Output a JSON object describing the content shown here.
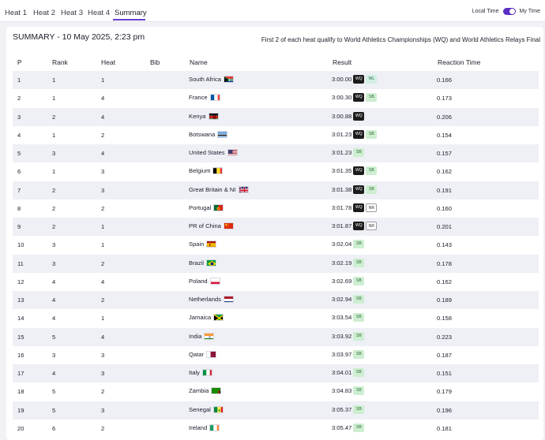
{
  "tabs": [
    "Heat 1",
    "Heat 2",
    "Heat 3",
    "Heat 4",
    "Summary"
  ],
  "active_tab": "Summary",
  "toggle": {
    "left_label": "Local Time",
    "right_label": "My Time"
  },
  "summary": {
    "title": "SUMMARY - 10 May 2025, 2:23 pm",
    "note": "First 2 of each heat qualify to World Athletics Championships (WQ) and World Athletics Relays Final"
  },
  "columns": {
    "p": "P",
    "rank": "Rank",
    "heat": "Heat",
    "bib": "Bib",
    "name": "Name",
    "result": "Result",
    "rt": "Reaction Time"
  },
  "colors": {
    "accent": "#6a3fd0",
    "row_alt": "#eef0f6",
    "wq": "#1c1c1c",
    "sb": "#cdeed0"
  },
  "rows": [
    {
      "p": "1",
      "rank": "1",
      "heat": "1",
      "name": "South Africa",
      "flag": "rsa",
      "result": "3:00.00",
      "badges": [
        "WQ",
        "WL"
      ],
      "rt": "0.166"
    },
    {
      "p": "2",
      "rank": "1",
      "heat": "4",
      "name": "France",
      "flag": "fra",
      "result": "3:00.30",
      "badges": [
        "WQ",
        "SB"
      ],
      "rt": "0.173"
    },
    {
      "p": "3",
      "rank": "2",
      "heat": "4",
      "name": "Kenya",
      "flag": "ken",
      "result": "3:00.88",
      "badges": [
        "WQ"
      ],
      "rt": "0.206"
    },
    {
      "p": "4",
      "rank": "1",
      "heat": "2",
      "name": "Botswana",
      "flag": "bot",
      "result": "3:01.23",
      "badges": [
        "WQ",
        "SB"
      ],
      "rt": "0.154"
    },
    {
      "p": "5",
      "rank": "3",
      "heat": "4",
      "name": "United States",
      "flag": "usa",
      "result": "3:01.23",
      "badges": [
        "SB"
      ],
      "rt": "0.157"
    },
    {
      "p": "6",
      "rank": "1",
      "heat": "3",
      "name": "Belgium",
      "flag": "bel",
      "result": "3:01.35",
      "badges": [
        "WQ",
        "SB"
      ],
      "rt": "0.162"
    },
    {
      "p": "7",
      "rank": "2",
      "heat": "3",
      "name": "Great Britain & NI",
      "flag": "gbr",
      "result": "3:01.38",
      "badges": [
        "WQ",
        "SB"
      ],
      "rt": "0.191"
    },
    {
      "p": "8",
      "rank": "2",
      "heat": "2",
      "name": "Portugal",
      "flag": "por",
      "result": "3:01.78",
      "badges": [
        "WQ",
        "NR"
      ],
      "rt": "0.160"
    },
    {
      "p": "9",
      "rank": "2",
      "heat": "1",
      "name": "PR of China",
      "flag": "chn",
      "result": "3:01.87",
      "badges": [
        "WQ",
        "NR"
      ],
      "rt": "0.201"
    },
    {
      "p": "10",
      "rank": "3",
      "heat": "1",
      "name": "Spain",
      "flag": "esp",
      "result": "3:02.04",
      "badges": [
        "SB"
      ],
      "rt": "0.143"
    },
    {
      "p": "11",
      "rank": "3",
      "heat": "2",
      "name": "Brazil",
      "flag": "bra",
      "result": "3:02.19",
      "badges": [
        "SB"
      ],
      "rt": "0.178"
    },
    {
      "p": "12",
      "rank": "4",
      "heat": "4",
      "name": "Poland",
      "flag": "pol",
      "result": "3:02.69",
      "badges": [
        "SB"
      ],
      "rt": "0.162"
    },
    {
      "p": "13",
      "rank": "4",
      "heat": "2",
      "name": "Netherlands",
      "flag": "ned",
      "result": "3:02.94",
      "badges": [
        "SB"
      ],
      "rt": "0.189"
    },
    {
      "p": "14",
      "rank": "4",
      "heat": "1",
      "name": "Jamaica",
      "flag": "jam",
      "result": "3:03.54",
      "badges": [
        "SB"
      ],
      "rt": "0.158"
    },
    {
      "p": "15",
      "rank": "5",
      "heat": "4",
      "name": "India",
      "flag": "ind",
      "result": "3:03.92",
      "badges": [
        "SB"
      ],
      "rt": "0.223"
    },
    {
      "p": "16",
      "rank": "3",
      "heat": "3",
      "name": "Qatar",
      "flag": "qat",
      "result": "3:03.97",
      "badges": [
        "SB"
      ],
      "rt": "0.187"
    },
    {
      "p": "17",
      "rank": "4",
      "heat": "3",
      "name": "Italy",
      "flag": "ita",
      "result": "3:04.01",
      "badges": [
        "SB"
      ],
      "rt": "0.151"
    },
    {
      "p": "18",
      "rank": "5",
      "heat": "2",
      "name": "Zambia",
      "flag": "zam",
      "result": "3:04.83",
      "badges": [
        "SB"
      ],
      "rt": "0.179"
    },
    {
      "p": "19",
      "rank": "5",
      "heat": "3",
      "name": "Senegal",
      "flag": "sen",
      "result": "3:05.37",
      "badges": [
        "SB"
      ],
      "rt": "0.196"
    },
    {
      "p": "20",
      "rank": "6",
      "heat": "2",
      "name": "Ireland",
      "flag": "irl",
      "result": "3:05.47",
      "badges": [
        "SB"
      ],
      "rt": "0.181"
    }
  ]
}
